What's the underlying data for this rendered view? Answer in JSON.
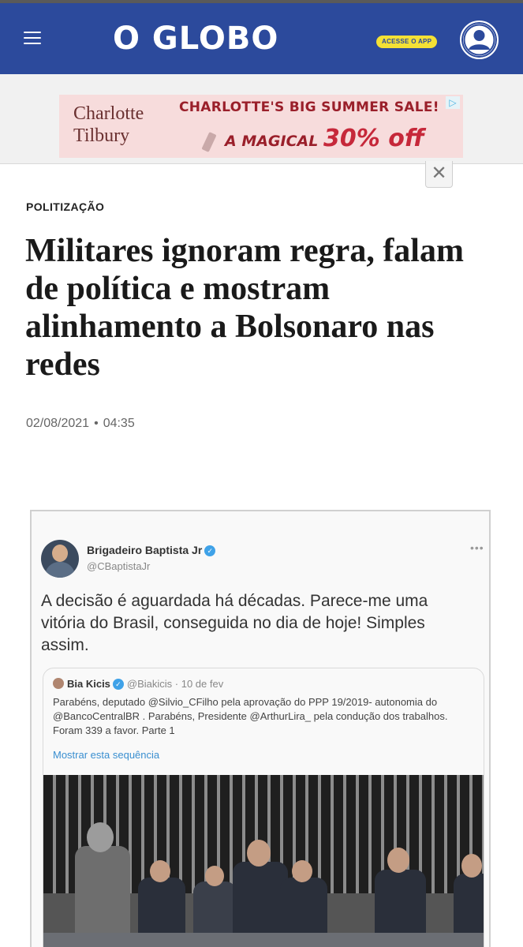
{
  "header": {
    "logo": "O GLOBO",
    "app_badge": "ACESSE O APP",
    "bg_color": "#2c4a9c",
    "badge_color": "#f4e135",
    "icons": [
      "menu-icon",
      "user-icon"
    ]
  },
  "ad": {
    "brand_line1": "Charlotte",
    "brand_line2": "Tilbury",
    "title": "CHARLOTTE'S BIG SUMMER SALE!",
    "sub_prefix": "A MAGICAL ",
    "sub_highlight": "30% off",
    "close_symbol": "✕",
    "choice_symbol": "▷"
  },
  "article": {
    "kicker": "POLITIZAÇÃO",
    "headline": "Militares ignoram regra, falam de política e mostram alinhamento a Bolsonaro nas redes",
    "date": "02/08/2021",
    "separator": "•",
    "time": "04:35"
  },
  "tweet": {
    "name": "Brigadeiro Baptista Jr",
    "handle": "@CBaptistaJr",
    "more": "•••",
    "text": "A decisão é aguardada há décadas. Parece-me uma vitória do Brasil, conseguida no dia de hoje! Simples assim.",
    "quote": {
      "name": "Bia Kicis",
      "handle_date": "@Biakicis · 10 de fev",
      "text": "Parabéns, deputado @Silvio_CFilho pela aprovação do PPP 19/2019- autonomia do @BancoCentralBR . Parabéns, Presidente @ArthurLira_ pela condução dos trabalhos. Foram 339 a favor. Parte 1",
      "link": "Mostrar esta sequência"
    }
  }
}
